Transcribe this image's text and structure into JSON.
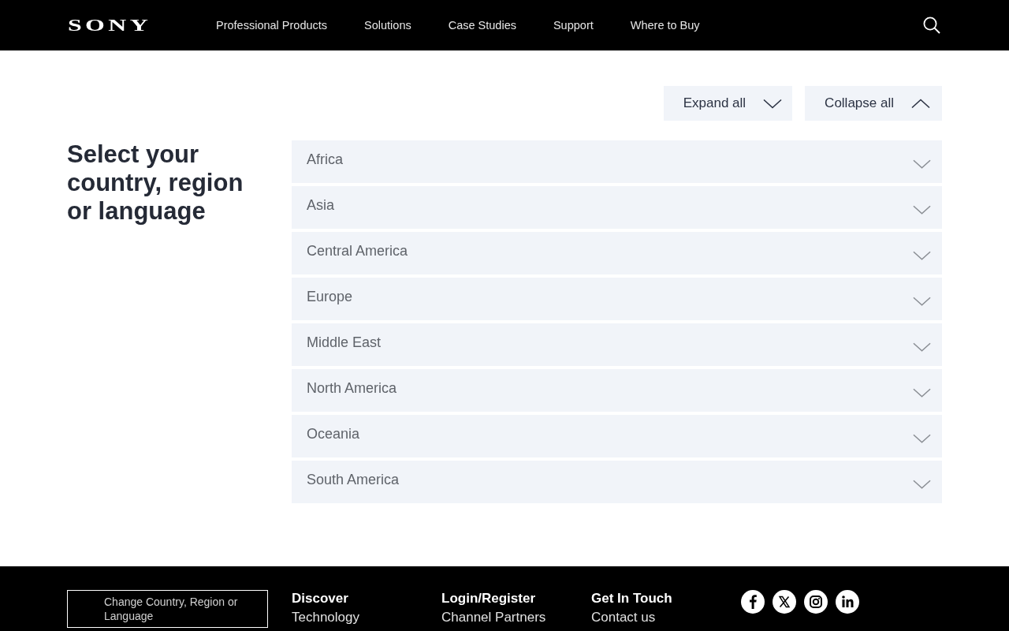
{
  "header": {
    "logo": "SONY",
    "nav": [
      "Professional Products",
      "Solutions",
      "Case Studies",
      "Support",
      "Where to Buy"
    ]
  },
  "controls": {
    "expand_all": "Expand all",
    "collapse_all": "Collapse all"
  },
  "title": "Select your country, region or language",
  "regions": [
    {
      "name": "Africa",
      "expanded": false
    },
    {
      "name": "Asia",
      "expanded": false
    },
    {
      "name": "Central America",
      "expanded": false
    },
    {
      "name": "Europe",
      "expanded": false
    },
    {
      "name": "Middle East",
      "expanded": false
    },
    {
      "name": "North America",
      "expanded": false
    },
    {
      "name": "Oceania",
      "expanded": false
    },
    {
      "name": "South America",
      "expanded": false
    }
  ],
  "footer": {
    "change_region": "Change Country, Region or Language",
    "columns": [
      {
        "heading": "Discover",
        "links": [
          "Technology"
        ]
      },
      {
        "heading": "Login/Register",
        "links": [
          "Channel Partners"
        ]
      },
      {
        "heading": "Get In Touch",
        "links": [
          "Contact us"
        ]
      }
    ]
  }
}
